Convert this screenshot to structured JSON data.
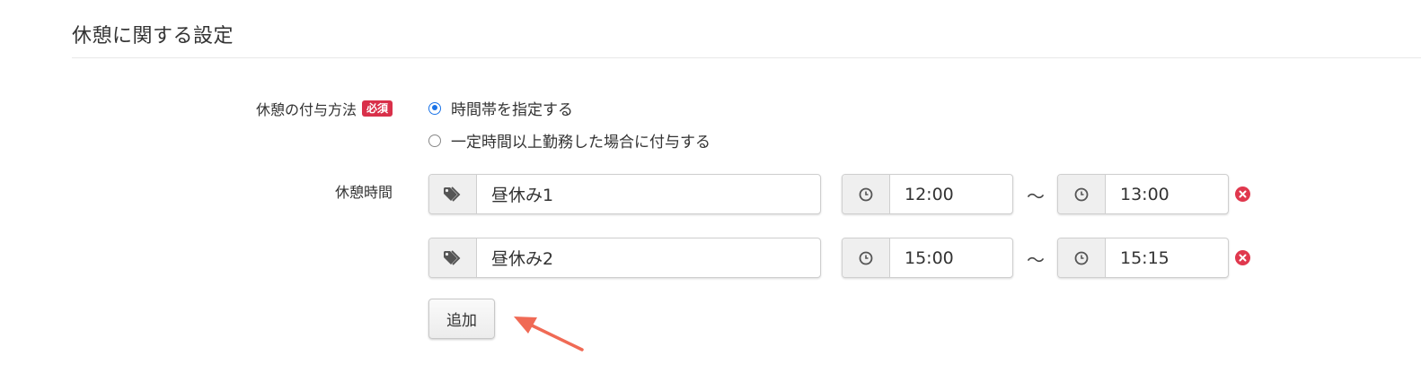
{
  "section": {
    "title": "休憩に関する設定"
  },
  "break_method": {
    "label": "休憩の付与方法",
    "required_badge": "必須",
    "options": [
      {
        "label": "時間帯を指定する",
        "selected": true
      },
      {
        "label": "一定時間以上勤務した場合に付与する",
        "selected": false
      }
    ]
  },
  "break_time": {
    "label": "休憩時間",
    "separator": "〜",
    "rows": [
      {
        "name": "昼休み1",
        "start": "12:00",
        "end": "13:00"
      },
      {
        "name": "昼休み2",
        "start": "15:00",
        "end": "15:15"
      }
    ]
  },
  "add_button": {
    "label": "追加"
  },
  "colors": {
    "accent": "#1a73e8",
    "danger": "#e0384e",
    "badge": "#d9304a",
    "arrow": "#f06a55"
  }
}
